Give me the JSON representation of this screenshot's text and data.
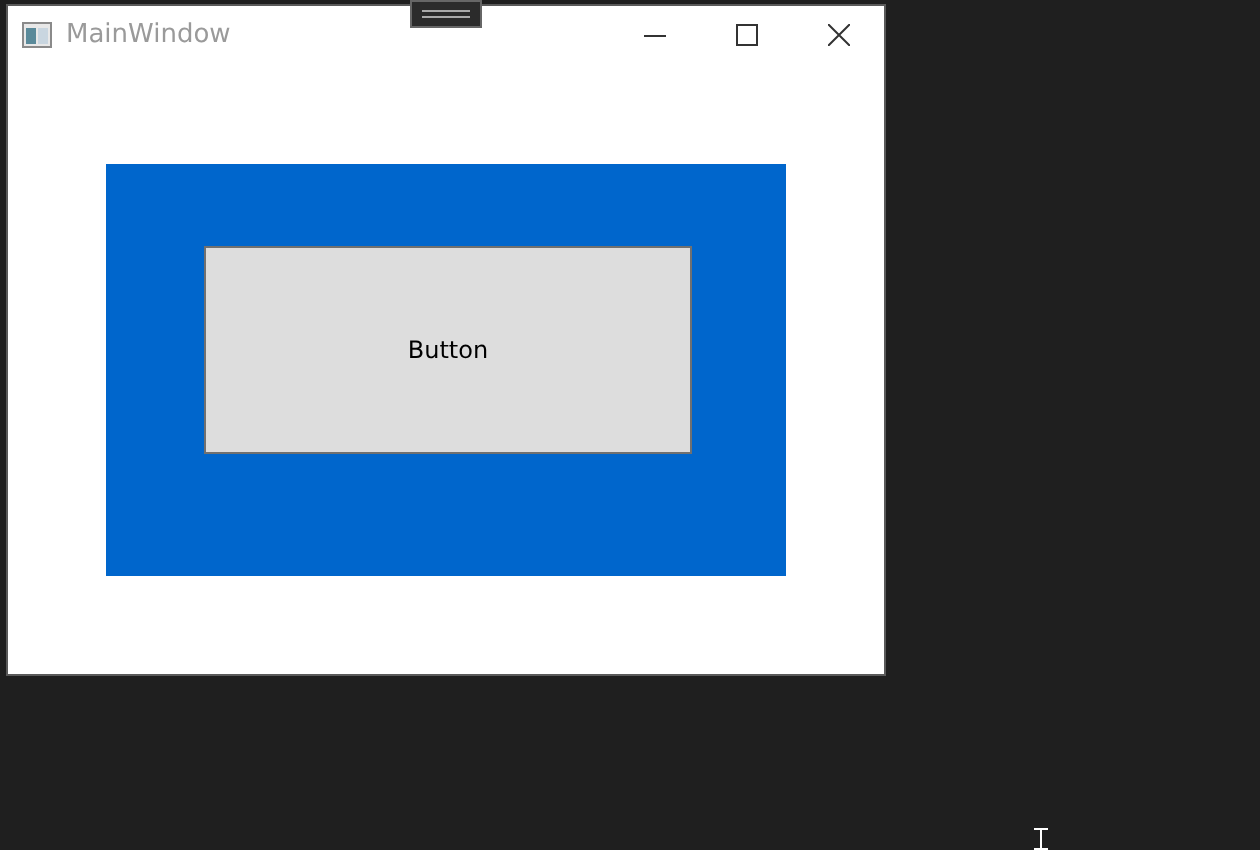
{
  "window": {
    "title": "MainWindow"
  },
  "button": {
    "label": "Button"
  }
}
